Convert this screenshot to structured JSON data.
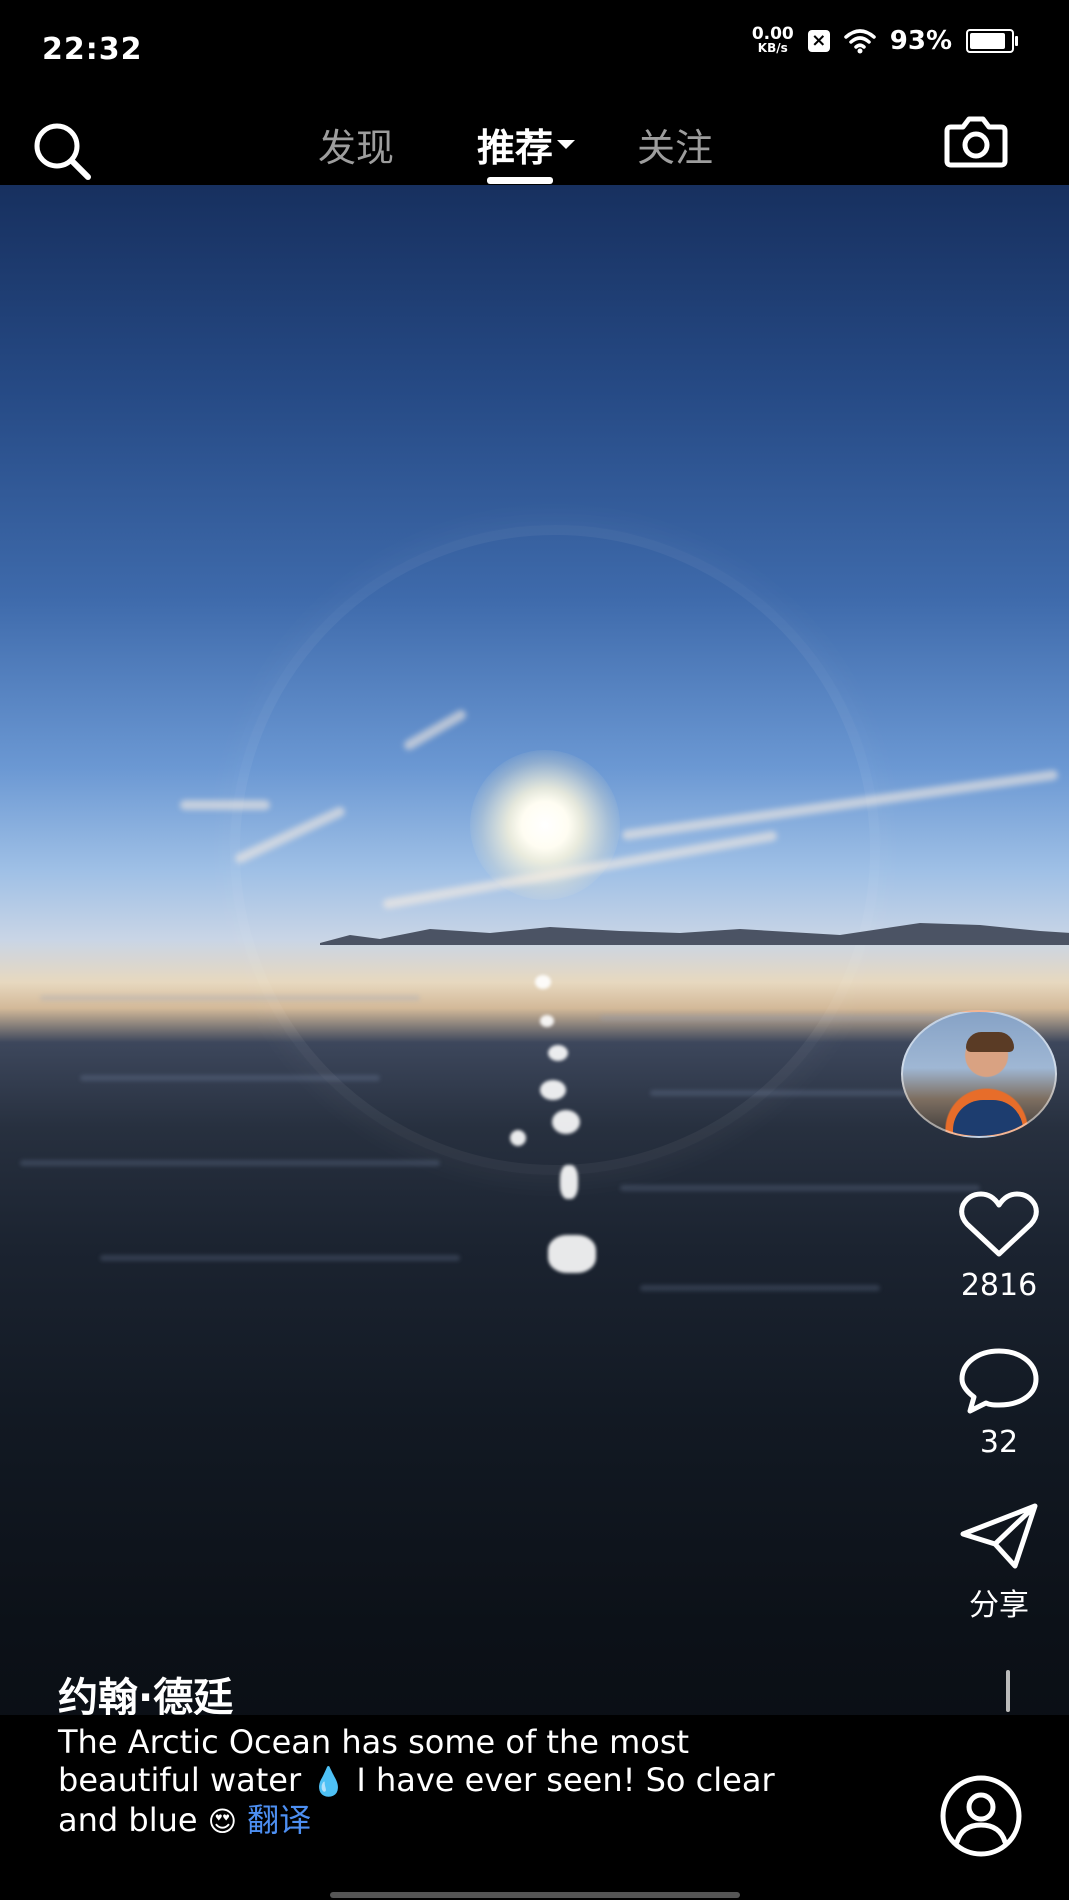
{
  "status_bar": {
    "time": "22:32",
    "net_speed_value": "0.00",
    "net_speed_unit": "KB/s",
    "battery_percent": "93%",
    "battery_level": 0.93,
    "icons": [
      "notification-x-icon",
      "wifi-icon",
      "battery-icon"
    ]
  },
  "top_nav": {
    "tabs": [
      {
        "label": "发现",
        "active": false
      },
      {
        "label": "推荐",
        "active": true
      },
      {
        "label": "关注",
        "active": false
      }
    ],
    "icons": [
      "search-icon",
      "camera-icon"
    ]
  },
  "video": {
    "author": "约翰·德廷",
    "caption_line1": "The Arctic Ocean has some of the most",
    "caption_line2_a": "beautiful water",
    "caption_line2_b": "I have ever seen! So clear",
    "caption_line3": "and blue",
    "emoji_droplet": "💧",
    "emoji_heart_eyes": "😍",
    "translate_label": "翻译"
  },
  "actions": {
    "like_count": "2816",
    "comment_count": "32",
    "share_label": "分享"
  },
  "colors": {
    "accent_link": "#4d8ff2",
    "inactive_tab": "#9d9d9d",
    "background": "#000000"
  }
}
